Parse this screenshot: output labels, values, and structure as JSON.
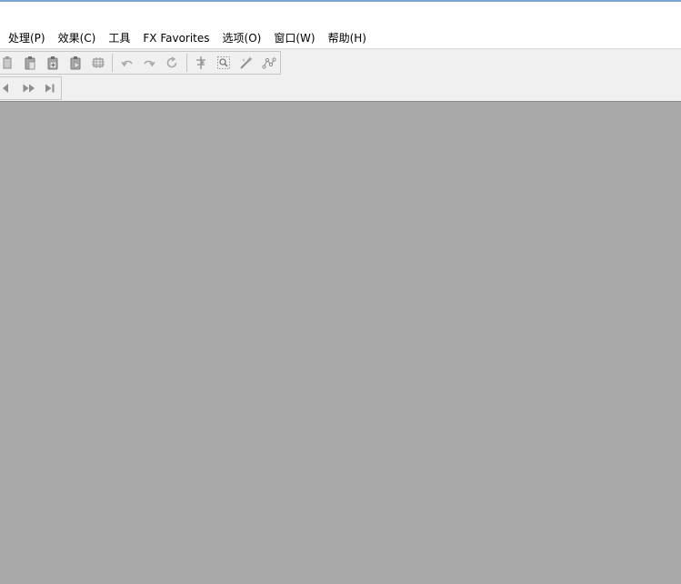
{
  "menubar": {
    "items": [
      {
        "label": "处理(P)"
      },
      {
        "label": "效果(C)"
      },
      {
        "label": "工具"
      },
      {
        "label": "FX Favorites"
      },
      {
        "label": "选项(O)"
      },
      {
        "label": "窗口(W)"
      },
      {
        "label": "帮助(H)"
      }
    ]
  },
  "toolbar_row1": {
    "icons": [
      "copy-icon",
      "paste-icon",
      "paste-new-icon",
      "paste-mix-icon",
      "crop-icon",
      "undo-icon",
      "redo-icon",
      "repeat-icon",
      "marker-icon",
      "zoom-icon",
      "magic-wand-icon",
      "envelope-icon"
    ]
  },
  "toolbar_row2": {
    "icons": [
      "rewind-icon",
      "fast-forward-icon",
      "skip-to-end-icon"
    ]
  },
  "colors": {
    "workspace": "#a9a9a9",
    "toolbar_bg": "#f0f0f0",
    "menubar_bg": "#ffffff",
    "top_accent": "#7aa6cf",
    "icon_gray": "#9a9a9a"
  }
}
